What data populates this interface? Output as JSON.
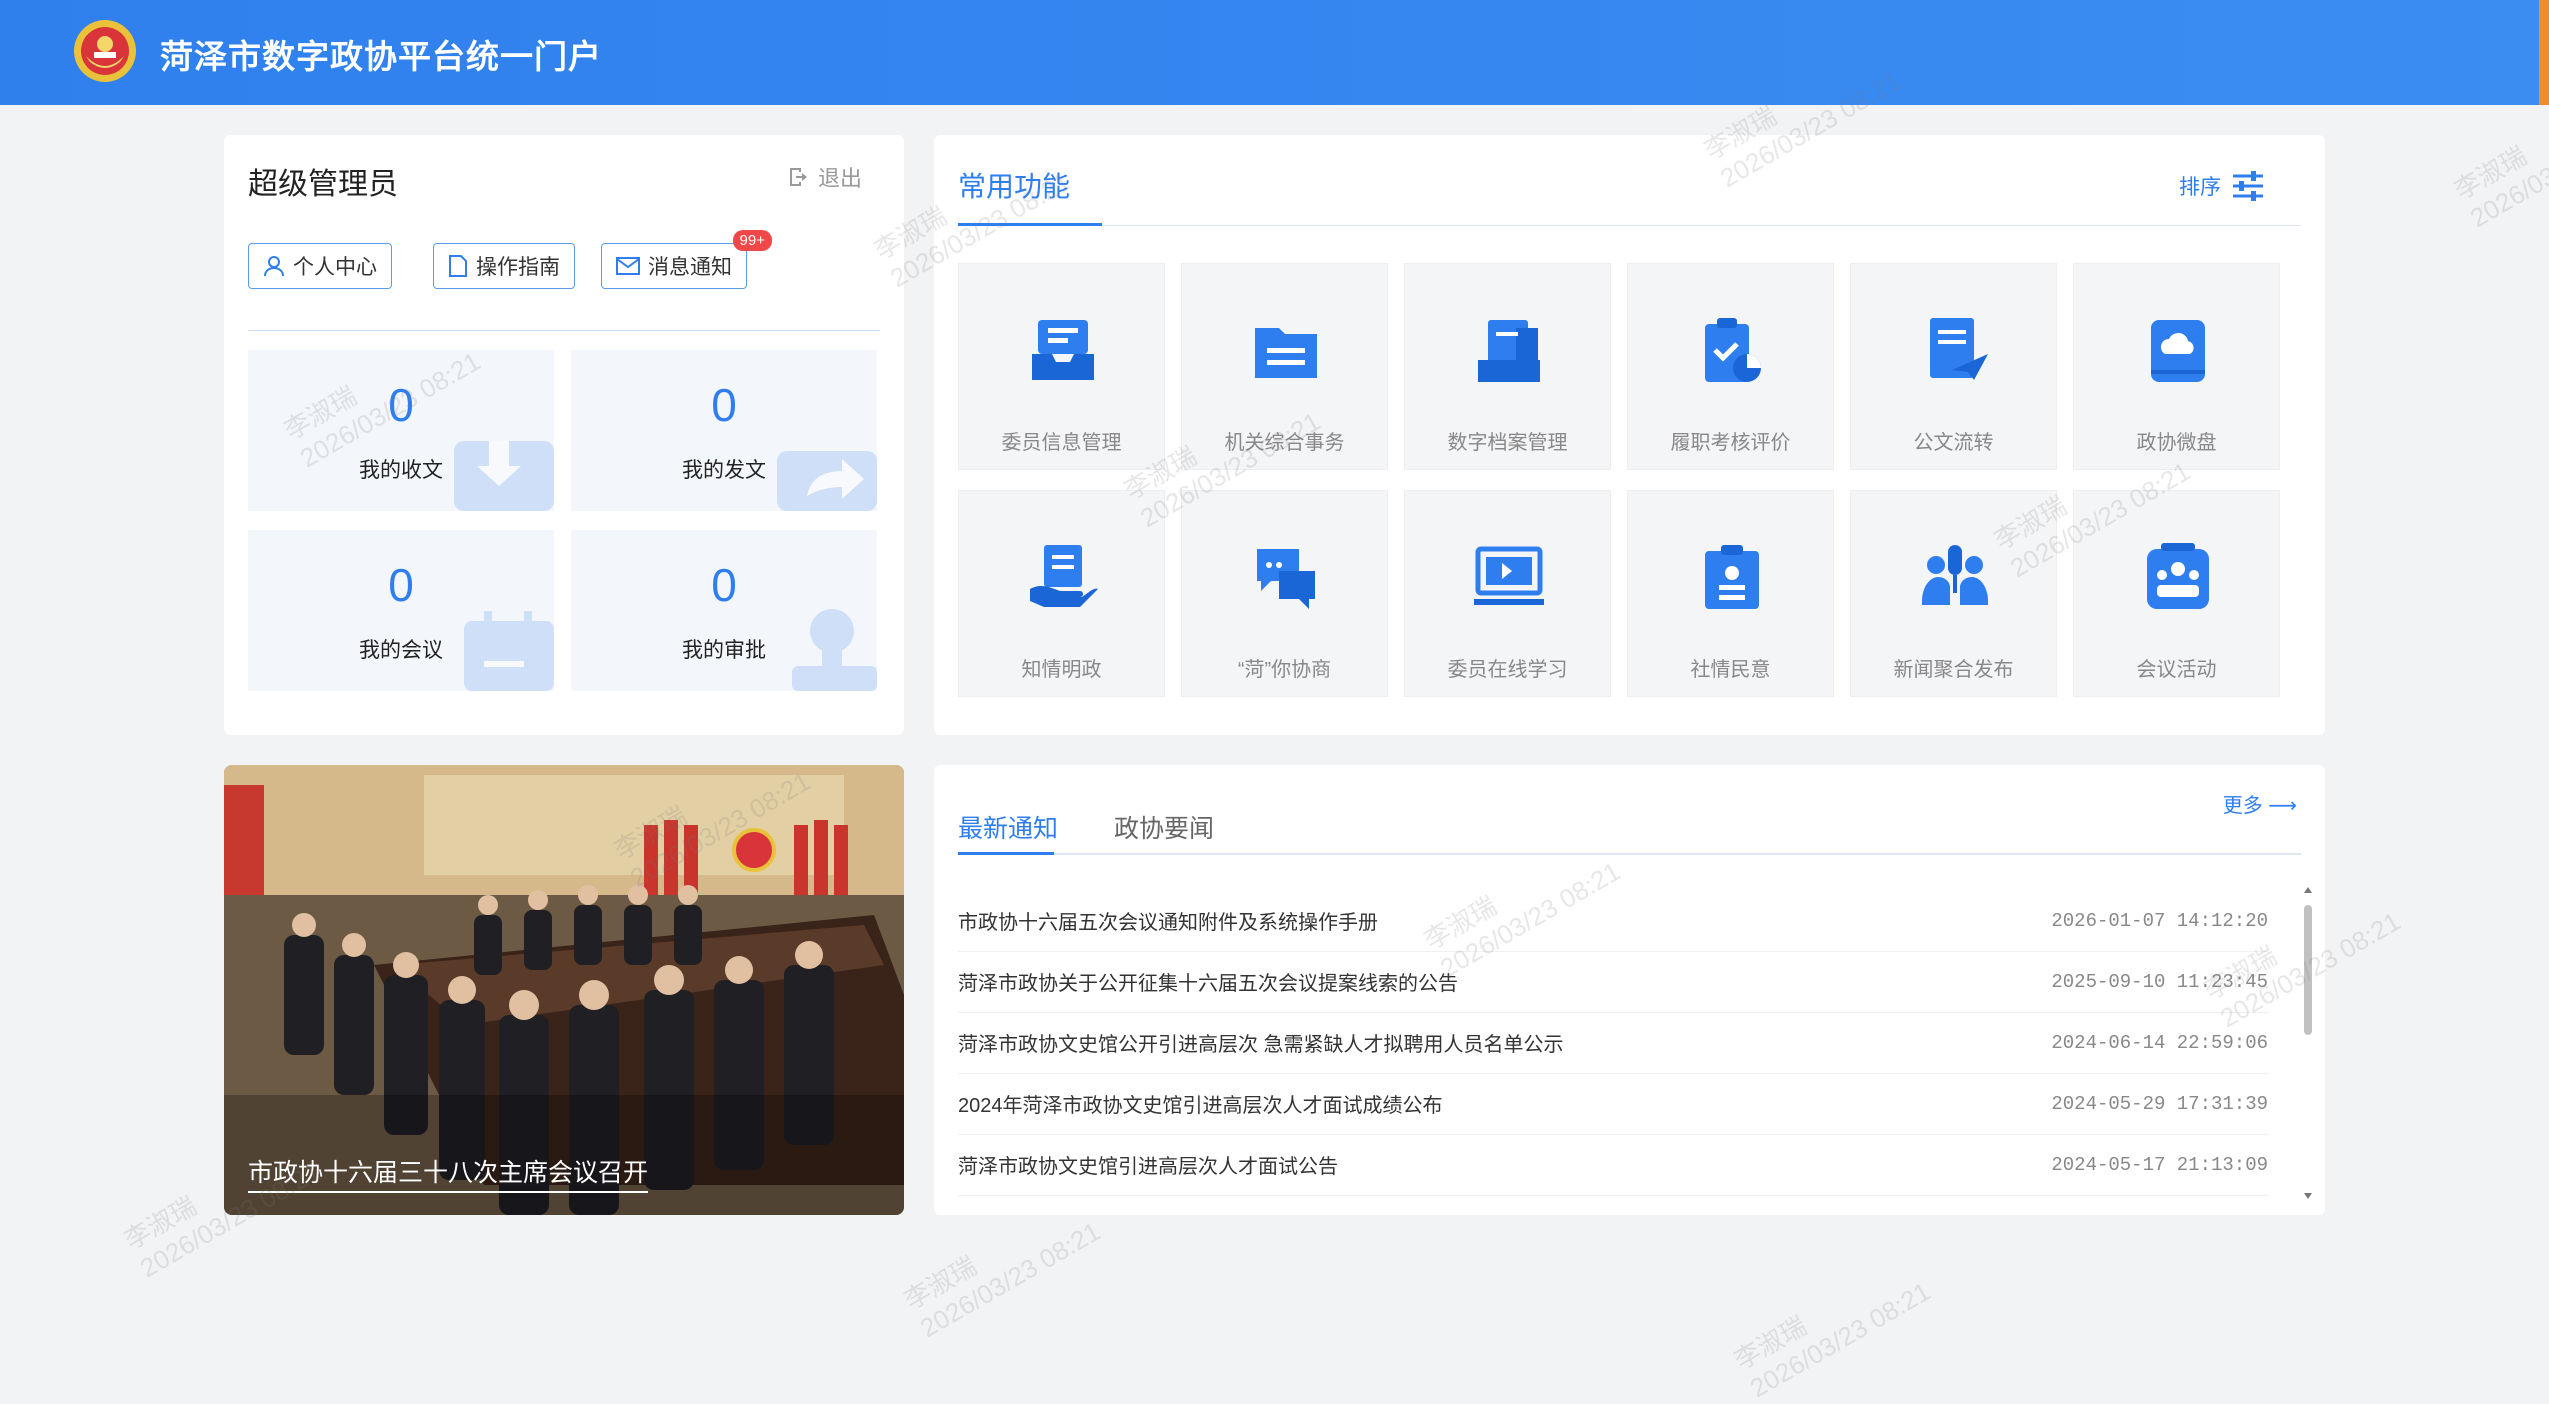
{
  "header": {
    "title": "菏泽市数字政协平台统一门户"
  },
  "user": {
    "name": "超级管理员",
    "logout": "退出",
    "buttons": {
      "personal": "个人中心",
      "guide": "操作指南",
      "messages": "消息通知",
      "message_badge": "99+"
    },
    "stats": [
      {
        "value": "0",
        "label": "我的收文"
      },
      {
        "value": "0",
        "label": "我的发文"
      },
      {
        "value": "0",
        "label": "我的会议"
      },
      {
        "value": "0",
        "label": "我的审批"
      }
    ]
  },
  "functions": {
    "title": "常用功能",
    "sort_label": "排序",
    "items": [
      {
        "label": "委员信息管理",
        "icon": "member-tray-icon"
      },
      {
        "label": "机关综合事务",
        "icon": "folder-list-icon"
      },
      {
        "label": "数字档案管理",
        "icon": "archive-icon"
      },
      {
        "label": "履职考核评价",
        "icon": "clipboard-chart-icon"
      },
      {
        "label": "公文流转",
        "icon": "document-send-icon"
      },
      {
        "label": "政协微盘",
        "icon": "cloud-drive-icon"
      },
      {
        "label": "知情明政",
        "icon": "hand-document-icon"
      },
      {
        "label": "“菏”你协商",
        "icon": "chat-bubbles-icon"
      },
      {
        "label": "委员在线学习",
        "icon": "online-learning-icon"
      },
      {
        "label": "社情民意",
        "icon": "clipboard-people-icon"
      },
      {
        "label": "新闻聚合发布",
        "icon": "microphone-people-icon"
      },
      {
        "label": "会议活动",
        "icon": "meeting-icon"
      }
    ]
  },
  "photo": {
    "caption": "市政协十六届三十八次主席会议召开"
  },
  "news": {
    "tabs": [
      "最新通知",
      "政协要闻"
    ],
    "more": "更多",
    "items": [
      {
        "title": "市政协十六届五次会议通知附件及系统操作手册",
        "date": "2026-01-07 14:12:20"
      },
      {
        "title": "菏泽市政协关于公开征集十六届五次会议提案线索的公告",
        "date": "2025-09-10 11:23:45"
      },
      {
        "title": "菏泽市政协文史馆公开引进高层次 急需紧缺人才拟聘用人员名单公示",
        "date": "2024-06-14 22:59:06"
      },
      {
        "title": "2024年菏泽市政协文史馆引进高层次人才面试成绩公布",
        "date": "2024-05-29 17:31:39"
      },
      {
        "title": "菏泽市政协文史馆引进高层次人才面试公告",
        "date": "2024-05-17 21:13:09"
      }
    ]
  },
  "watermark": {
    "name": "李淑瑞",
    "time": "2026/03/23 08:21"
  },
  "colors": {
    "primary": "#2f7ef0",
    "header": "#2f80ed",
    "badge": "#f04848"
  }
}
